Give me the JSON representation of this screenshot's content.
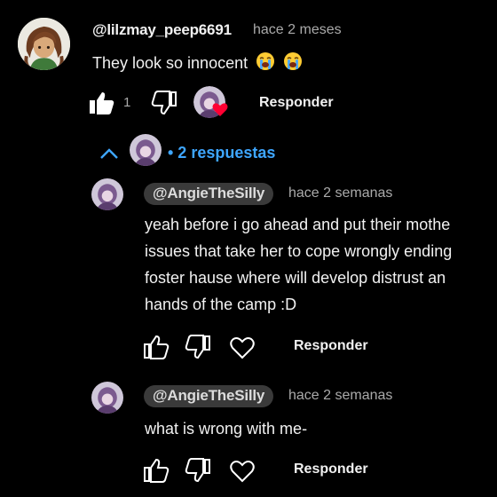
{
  "comment": {
    "username": "@lilzmay_peep6691",
    "timestamp": "hace 2 meses",
    "text": "They look so innocent",
    "emojis": [
      "loudly-crying-face-emoji",
      "loudly-crying-face-emoji"
    ],
    "like_count": "1",
    "reply_label": "Responder"
  },
  "replies_toggle": {
    "label": "• 2 respuestas"
  },
  "replies": [
    {
      "username": "@AngieTheSilly",
      "timestamp": "hace 2 semanas",
      "lines": [
        "yeah before i go ahead and put their mothe",
        "issues that take her to cope wrongly ending",
        "foster hause where will develop distrust an",
        "hands of the camp :D"
      ],
      "reply_label": "Responder"
    },
    {
      "username": "@AngieTheSilly",
      "timestamp": "hace 2 semanas",
      "lines": [
        "what is wrong with me-"
      ],
      "reply_label": "Responder"
    }
  ],
  "colors": {
    "background": "#000000",
    "link_blue": "#3ea6ff",
    "chip_bg": "#3a3a3a",
    "heart_red": "#ff0033",
    "muted": "#aaaaaa"
  }
}
